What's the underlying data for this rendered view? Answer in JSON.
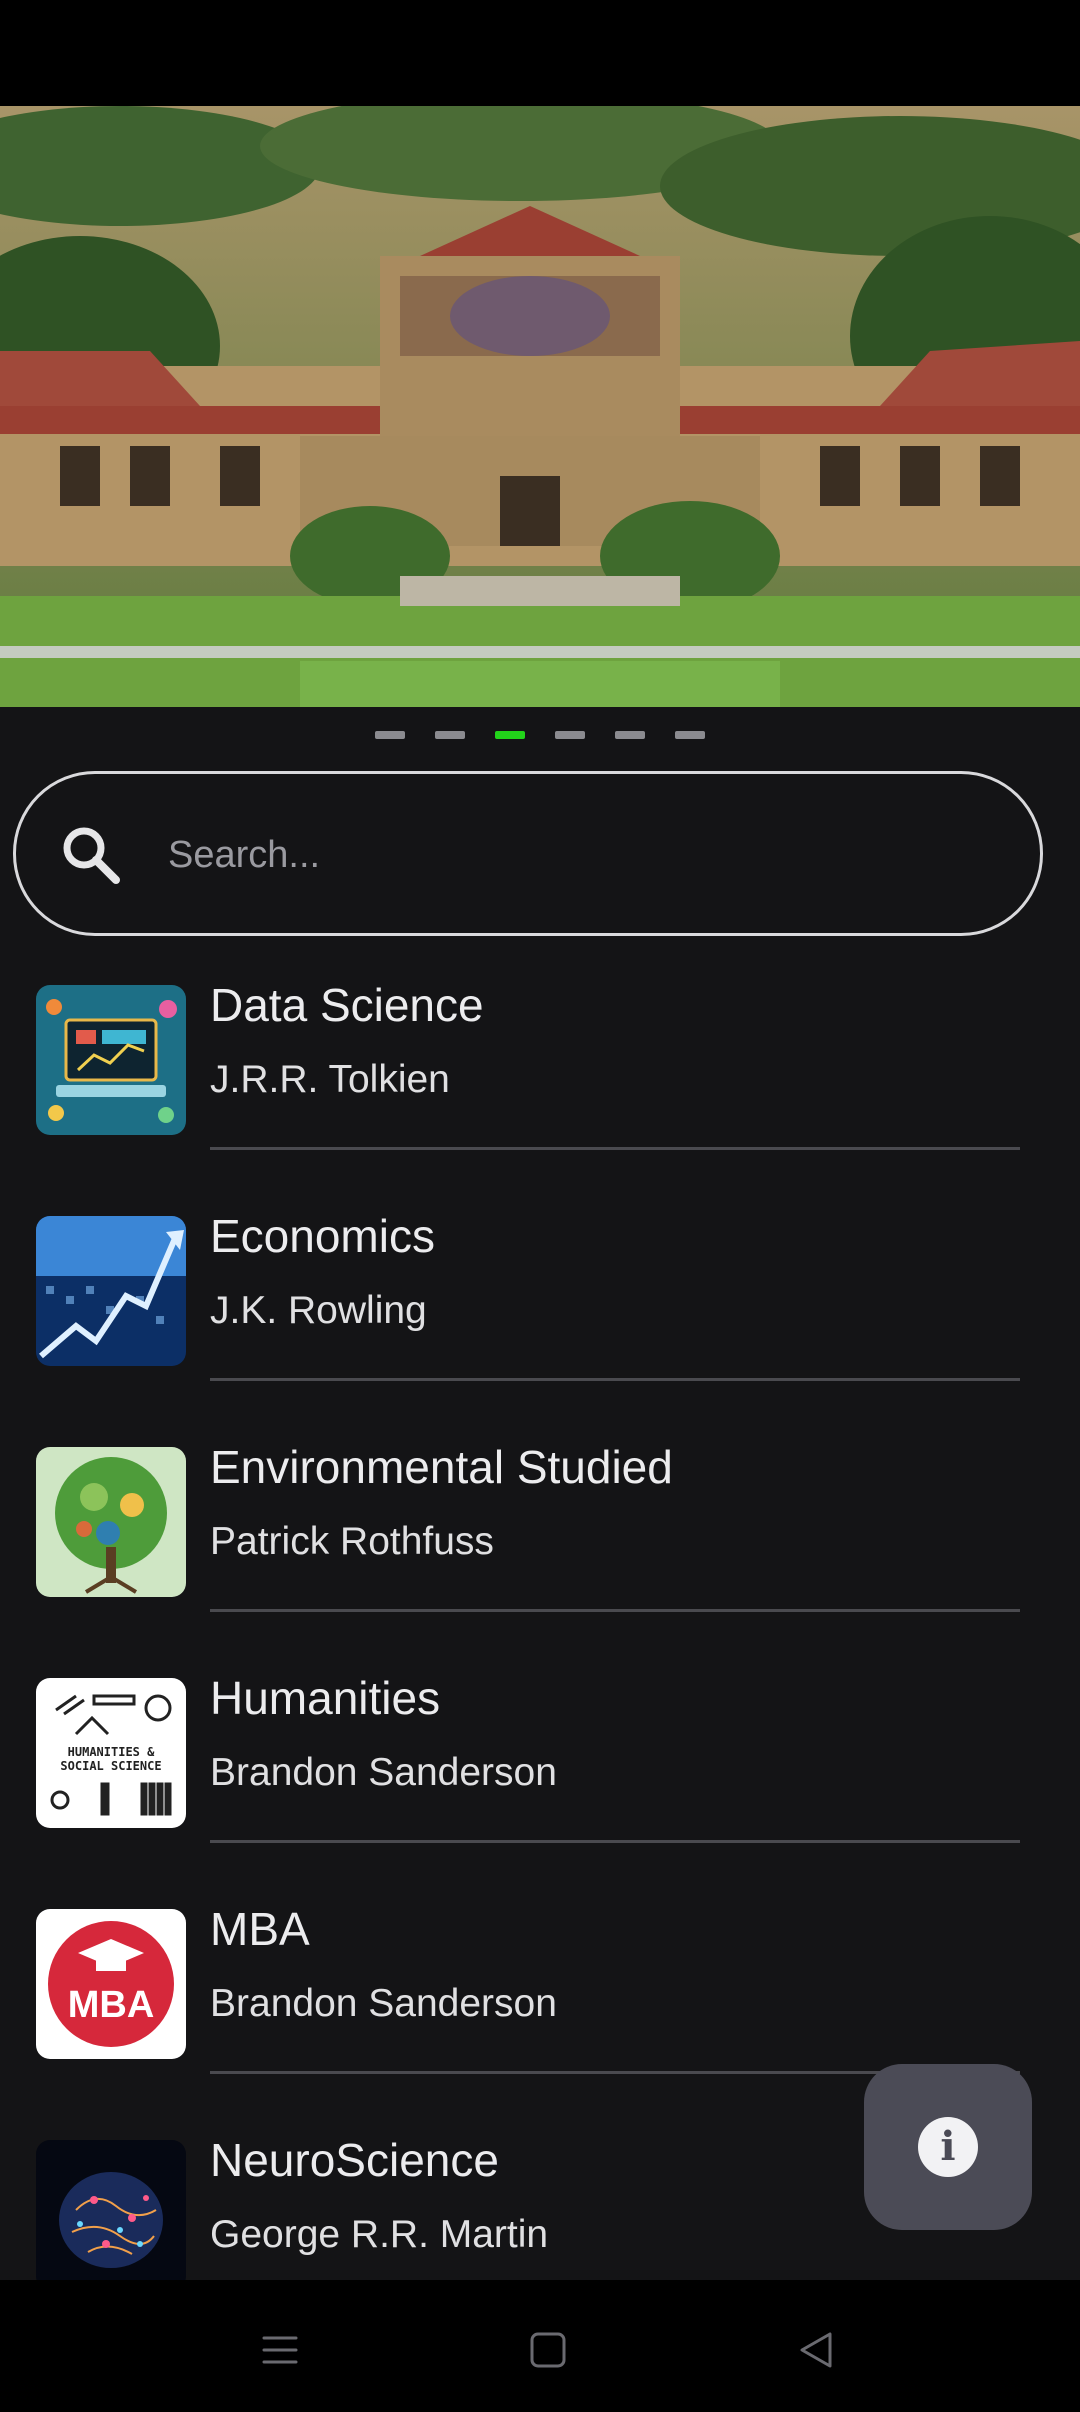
{
  "carousel": {
    "slide_count": 6,
    "active_index": 2
  },
  "search": {
    "placeholder": "Search..."
  },
  "courses": [
    {
      "title": "Data Science",
      "author": "J.R.R. Tolkien",
      "thumb": "data-science-illustration"
    },
    {
      "title": "Economics",
      "author": "J.K. Rowling",
      "thumb": "stock-chart-image"
    },
    {
      "title": "Environmental Studied",
      "author": "Patrick Rothfuss",
      "thumb": "tree-globe-illustration"
    },
    {
      "title": "Humanities",
      "author": "Brandon Sanderson",
      "thumb": "humanities-social-science-sketch"
    },
    {
      "title": "MBA",
      "author": "Brandon Sanderson",
      "thumb": "mba-logo"
    },
    {
      "title": "NeuroScience",
      "author": "George R.R. Martin",
      "thumb": "brain-neurons-image"
    }
  ],
  "thumb_texts": {
    "humanities_line1": "HUMANITIES &",
    "humanities_line2": "SOCIAL SCIENCE",
    "mba": "MBA"
  },
  "fab": {
    "icon": "info-icon",
    "glyph": "i"
  },
  "nav": {
    "menu_icon": "menu-icon",
    "home_icon": "home-square-icon",
    "back_icon": "back-triangle-icon"
  },
  "colors": {
    "active_dot": "#22d41a",
    "background": "#141416",
    "fab": "#4b4b56"
  }
}
